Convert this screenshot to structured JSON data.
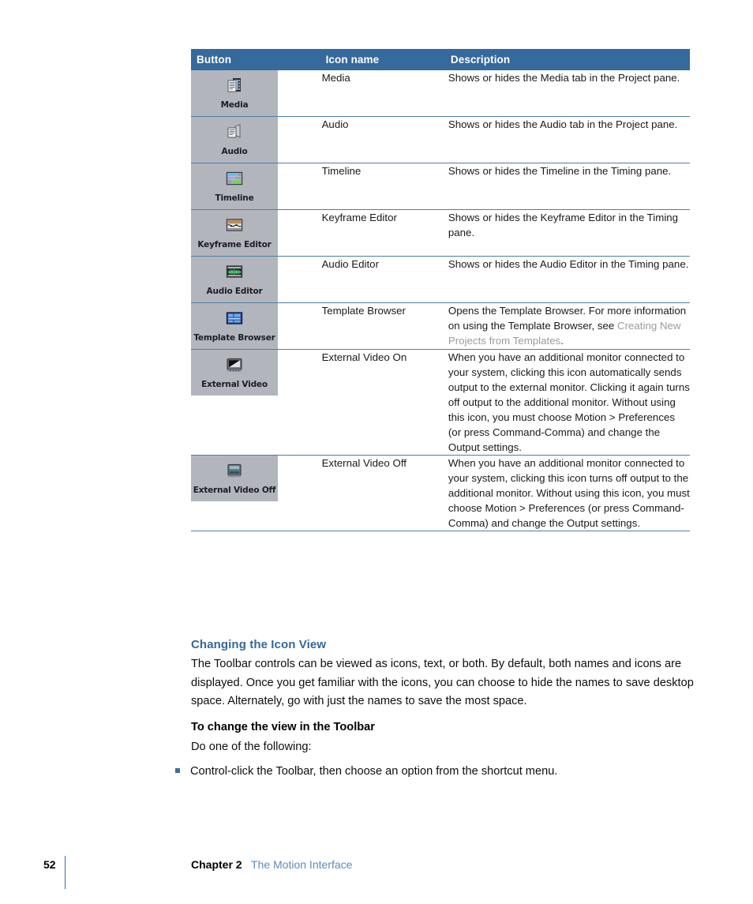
{
  "table": {
    "headers": [
      "Button",
      "Icon name",
      "Description"
    ],
    "rows": [
      {
        "chip_caption": "Media",
        "icon": "media-filmstrip-icon",
        "icon_name": "Media",
        "description": "Shows or hides the Media tab in the Project pane.",
        "description_link": "",
        "description_tail": ""
      },
      {
        "chip_caption": "Audio",
        "icon": "audio-speaker-icon",
        "icon_name": "Audio",
        "description": "Shows or hides the Audio tab in the Project pane.",
        "description_link": "",
        "description_tail": ""
      },
      {
        "chip_caption": "Timeline",
        "icon": "timeline-bars-icon",
        "icon_name": "Timeline",
        "description": "Shows or hides the Timeline in the Timing pane.",
        "description_link": "",
        "description_tail": ""
      },
      {
        "chip_caption": "Keyframe Editor",
        "icon": "keyframe-curve-icon",
        "icon_name": "Keyframe Editor",
        "description": "Shows or hides the Keyframe Editor in the Timing pane.",
        "description_link": "",
        "description_tail": ""
      },
      {
        "chip_caption": "Audio Editor",
        "icon": "audio-waveform-icon",
        "icon_name": "Audio Editor",
        "description": "Shows or hides the Audio Editor in the Timing pane.",
        "description_link": "",
        "description_tail": ""
      },
      {
        "chip_caption": "Template Browser",
        "icon": "template-browser-icon",
        "icon_name": "Template Browser",
        "description": "Opens the Template Browser. For more information on using the Template Browser, see ",
        "description_link": "Creating New Projects from Templates",
        "description_tail": "."
      },
      {
        "chip_caption": "External Video",
        "icon": "external-video-on-icon",
        "icon_name": "External Video On",
        "description": "When you have an additional monitor connected to your system, clicking this icon automatically sends output to the external monitor. Clicking it again turns off output to the additional monitor. Without using this icon, you must choose Motion > Preferences (or press Command-Comma) and change the Output settings.",
        "description_link": "",
        "description_tail": ""
      },
      {
        "chip_caption": "External Video Off",
        "icon": "external-video-off-icon",
        "icon_name": "External Video Off",
        "description": "When you have an additional monitor connected to your system, clicking this icon turns off output to the additional monitor. Without using this icon, you must choose Motion > Preferences (or press Command-Comma) and change the Output settings.",
        "description_link": "",
        "description_tail": ""
      }
    ]
  },
  "content": {
    "section_heading": "Changing the Icon View",
    "paragraph_1": "The Toolbar controls can be viewed as icons, text, or both. By default, both names and icons are displayed. Once you get familiar with the icons, you can choose to hide the names to save desktop space. Alternately, go with just the names to save the most space.",
    "sub_heading": "To change the view in the Toolbar",
    "paragraph_2": "Do one of the following:",
    "bullet_1": "Control-click the Toolbar, then choose an option from the shortcut menu."
  },
  "footer": {
    "page_number": "52",
    "chapter_label": "Chapter 2",
    "chapter_title": "The Motion Interface"
  },
  "colors": {
    "header_blue": "#36699c",
    "rule_blue": "#4d7ea8",
    "heading_blue": "#33679b",
    "link_gray": "#9b9b9b",
    "footer_link_blue": "#5b8cbe",
    "chip_gray": "#b3b5bd"
  }
}
